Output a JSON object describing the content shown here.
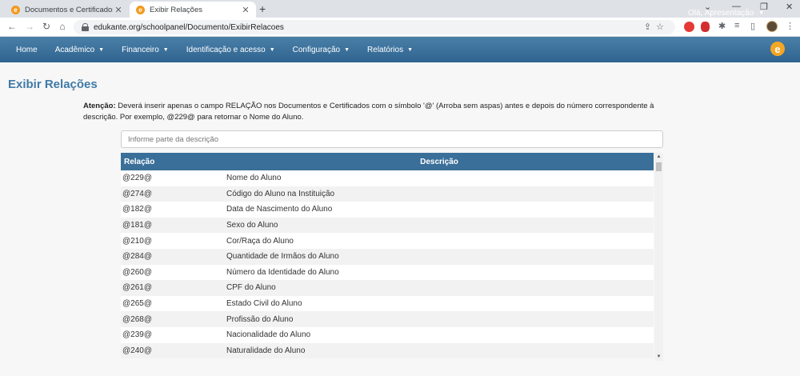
{
  "browser": {
    "tabs": [
      {
        "title": "Documentos e Certificados"
      },
      {
        "title": "Exibir Relações"
      }
    ],
    "url": "edukante.org/schoolpanel/Documento/ExibirRelacoes"
  },
  "navbar": {
    "items": [
      {
        "label": "Home"
      },
      {
        "label": "Acadêmico"
      },
      {
        "label": "Financeiro"
      },
      {
        "label": "Identificação e acesso"
      },
      {
        "label": "Configuração"
      },
      {
        "label": "Relatórios"
      }
    ],
    "user_label": "Olá, Apresentação",
    "logo_letter": "e"
  },
  "page": {
    "title": "Exibir Relações",
    "notice_label": "Atenção:",
    "notice_text": "Deverá inserir apenas o campo RELAÇÃO nos Documentos e Certificados com o símbolo '@' (Arroba sem aspas) antes e depois do número correspondente à descrição. Por exemplo, @229@ para retornar o Nome do Aluno.",
    "filter_placeholder": "Informe parte da descrição"
  },
  "table": {
    "columns": [
      "Relação",
      "Descrição"
    ],
    "rows": [
      [
        "@229@",
        "Nome do Aluno"
      ],
      [
        "@274@",
        "Código do Aluno na Instituição"
      ],
      [
        "@182@",
        "Data de Nascimento do Aluno"
      ],
      [
        "@181@",
        "Sexo do Aluno"
      ],
      [
        "@210@",
        "Cor/Raça do Aluno"
      ],
      [
        "@284@",
        "Quantidade de Irmãos do Aluno"
      ],
      [
        "@260@",
        "Número da Identidade do Aluno"
      ],
      [
        "@261@",
        "CPF do Aluno"
      ],
      [
        "@265@",
        "Estado Civil do Aluno"
      ],
      [
        "@268@",
        "Profissão do Aluno"
      ],
      [
        "@239@",
        "Nacionalidade do Aluno"
      ],
      [
        "@240@",
        "Naturalidade do Aluno"
      ]
    ]
  },
  "colors": {
    "navbar": "#3a6f99",
    "title": "#3f7aa7",
    "brand": "#f5a623"
  }
}
